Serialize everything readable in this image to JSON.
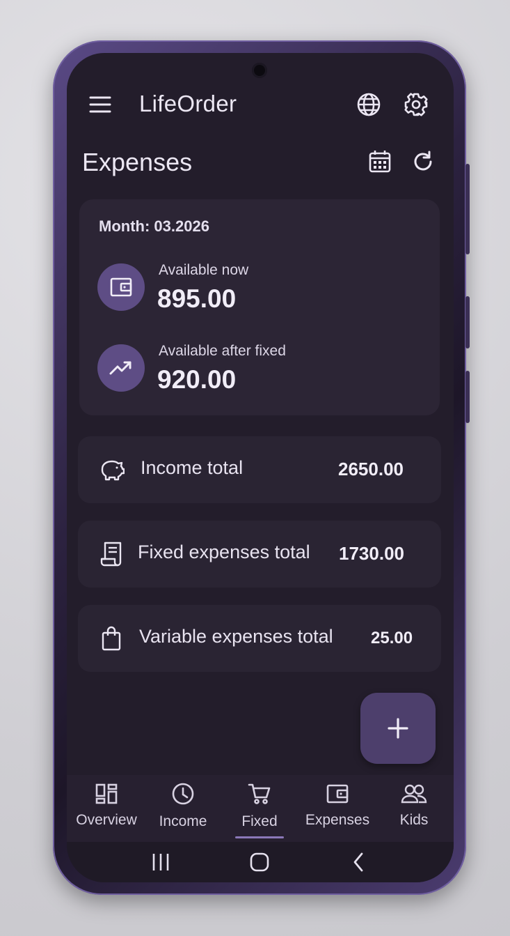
{
  "app": {
    "title": "LifeOrder"
  },
  "header": {
    "menu_icon": "menu-icon",
    "language_icon": "globe-icon",
    "settings_icon": "gear-icon"
  },
  "page": {
    "title": "Expenses",
    "calendar_icon": "calendar-icon",
    "refresh_icon": "refresh-icon"
  },
  "summary": {
    "month_label": "Month: 03.2026",
    "available_now": {
      "label": "Available now",
      "value": "895.00",
      "icon": "wallet-icon"
    },
    "available_after_fixed": {
      "label": "Available after fixed",
      "value": "920.00",
      "icon": "trending-up-icon"
    }
  },
  "totals": [
    {
      "label": "Income total",
      "value": "2650.00",
      "icon": "piggy-bank-icon"
    },
    {
      "label": "Fixed expenses total",
      "value": "1730.00",
      "icon": "receipt-icon"
    },
    {
      "label": "Variable expenses total",
      "value": "25.00",
      "icon": "shopping-bag-icon"
    }
  ],
  "fab": {
    "icon": "plus-icon"
  },
  "bottom_nav": {
    "items": [
      {
        "label": "Overview",
        "icon": "dashboard-icon"
      },
      {
        "label": "Income",
        "icon": "clock-icon"
      },
      {
        "label": "Fixed",
        "icon": "cart-icon"
      },
      {
        "label": "Expenses",
        "icon": "wallet-icon"
      },
      {
        "label": "Kids",
        "icon": "people-icon"
      }
    ],
    "selected": "Fixed"
  },
  "system_nav": {
    "recents_icon": "recents-icon",
    "home_icon": "home-icon",
    "back_icon": "back-icon"
  },
  "colors": {
    "background": "#231d2b",
    "card": "#2c2535",
    "accent": "#5e4d85",
    "fab": "#4d3f6c",
    "text": "#ece7f3"
  }
}
